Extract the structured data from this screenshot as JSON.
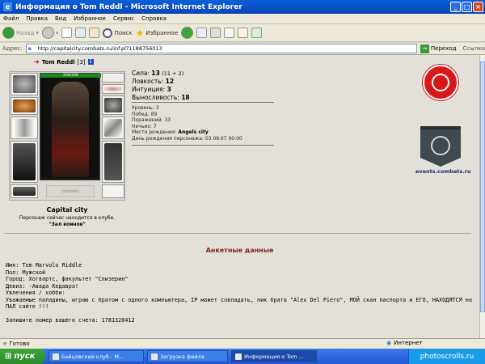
{
  "window": {
    "title": "Информация о Tom Reddl - Microsoft Internet Explorer"
  },
  "menu": [
    "Файл",
    "Правка",
    "Вид",
    "Избранное",
    "Сервис",
    "Справка"
  ],
  "toolbar": {
    "back": "Назад",
    "search": "Поиск",
    "favorites": "Избранное"
  },
  "address": {
    "label": "Адрес:",
    "url": "http://capitalcity.combats.ru/inf.pl?1188756013",
    "go": "Переход",
    "links": "Ссылки"
  },
  "character": {
    "name": "Tom Reddl",
    "level": "[3]",
    "hp": "206/206",
    "city": "Capital city",
    "location_text": "Персонаж сейчас находится в клубе.",
    "location_room": "\"Зал воинов\"",
    "emblem_text": "combats",
    "stats": [
      {
        "label": "Сила:",
        "value": "13",
        "extra": "(11 + 2)"
      },
      {
        "label": "Ловкость:",
        "value": "12",
        "extra": ""
      },
      {
        "label": "Интуиция:",
        "value": "3",
        "extra": ""
      },
      {
        "label": "Выносливость:",
        "value": "18",
        "extra": ""
      }
    ],
    "details": [
      {
        "label": "Уровень:",
        "value": "3"
      },
      {
        "label": "Побед:",
        "value": "89"
      },
      {
        "label": "Поражений:",
        "value": "33"
      },
      {
        "label": "Ничьих:",
        "value": "7"
      },
      {
        "label": "Место рождения:",
        "value": "Angels city"
      },
      {
        "label": "День рождения персонажа:",
        "value": "03.09.07 00:00"
      }
    ]
  },
  "logos": {
    "events_url": "events.combats.ru"
  },
  "anket": {
    "title": "Анкетные данные",
    "name": "Имя: Tom Marvolo Riddle",
    "gender": "Пол: Мужской",
    "city": "Город: Хогвартс, факультет \"Слизерин\"",
    "motto": "Девиз: -Авада Кедавра!",
    "hobby": "Увлечения / хобби:",
    "hobby_text": "Уважаемые паладины, играю с братом с одного компьютера, IP может совпадать, ник брата \"Alex Del Piero\", МОЙ скан паспорта и ЕГО, НАХОДЯТСЯ на ПАЛ сайте !!!",
    "account": "Запишите номер вашего счета: 1781320412"
  },
  "status": {
    "text": "Готово",
    "zone": "Интернет"
  },
  "taskbar": {
    "start": "пуск",
    "tasks": [
      "Бойцовский клуб - М...",
      "Загрузка файла",
      "Информация о Tom ..."
    ],
    "tray": "photoscrolls.ru"
  }
}
